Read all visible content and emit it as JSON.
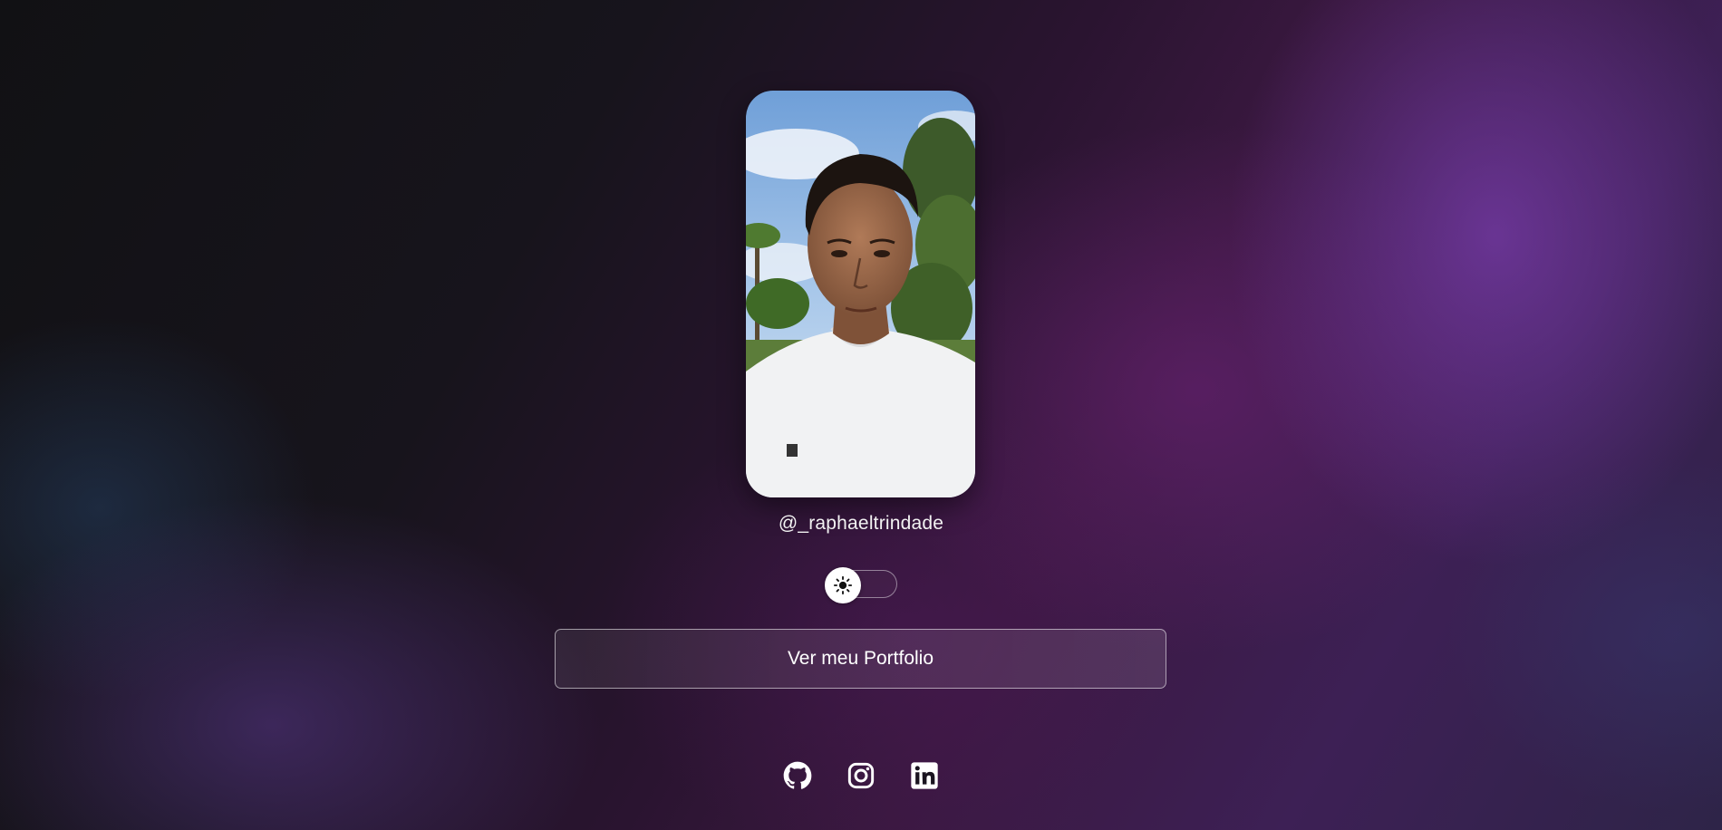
{
  "profile": {
    "username": "@_raphaeltrindade",
    "photo_alt": "profile-photo"
  },
  "theme_toggle": {
    "state": "light",
    "icon": "sun-icon"
  },
  "cta": {
    "label": "Ver meu Portfolio"
  },
  "socials": [
    {
      "name": "GitHub",
      "icon": "github-icon"
    },
    {
      "name": "Instagram",
      "icon": "instagram-icon"
    },
    {
      "name": "LinkedIn",
      "icon": "linkedin-icon"
    }
  ],
  "colors": {
    "text": "#ffffff",
    "accent_purple": "#6a2f8f",
    "background_dark": "#111114"
  }
}
